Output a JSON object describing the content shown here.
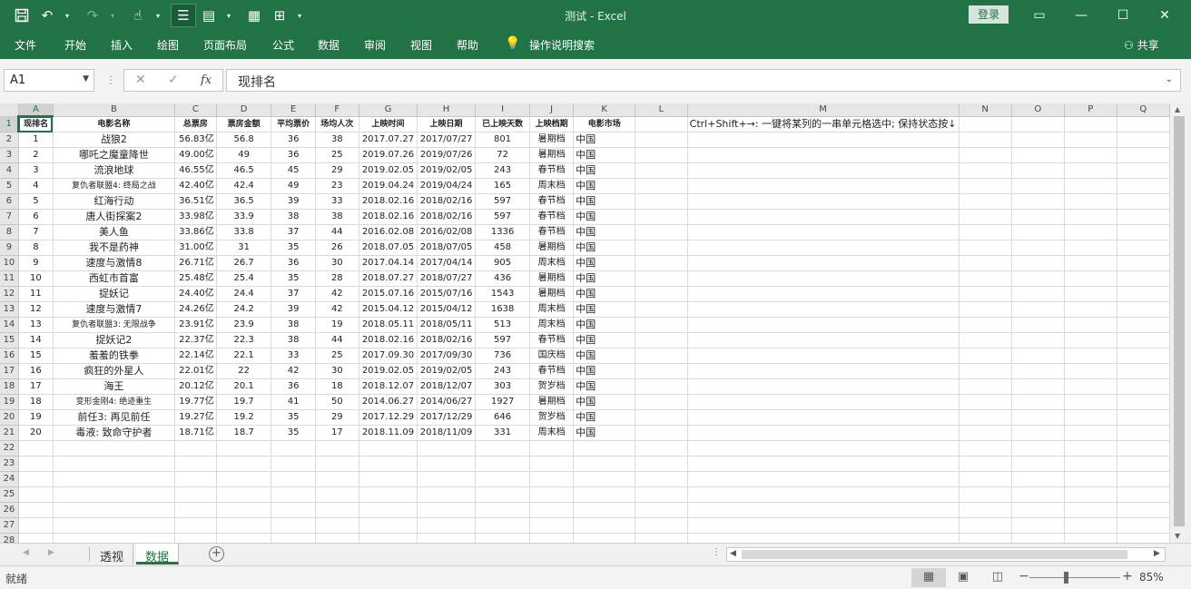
{
  "window": {
    "title": "测试  -  Excel",
    "login_label": "登录"
  },
  "qat": {
    "icons": [
      "save-icon",
      "undo-icon",
      "redo-icon",
      "touch-mode-icon",
      "align-icon",
      "layout-icon",
      "border-icon",
      "grid-icon",
      "customize-icon"
    ]
  },
  "ribbon": {
    "tabs": [
      "文件",
      "开始",
      "插入",
      "绘图",
      "页面布局",
      "公式",
      "数据",
      "审阅",
      "视图",
      "帮助"
    ],
    "tell_me": "操作说明搜索",
    "share": "共享"
  },
  "formula_bar": {
    "name_box": "A1",
    "value": "现排名"
  },
  "sheet": {
    "columns": [
      "A",
      "B",
      "C",
      "D",
      "E",
      "F",
      "G",
      "H",
      "I",
      "J",
      "K",
      "L",
      "M",
      "N",
      "O",
      "P",
      "Q"
    ],
    "headers": [
      "现排名",
      "电影名称",
      "总票房",
      "票房金额",
      "平均票价",
      "场均人次",
      "上映时间",
      "上映日期",
      "已上映天数",
      "上映档期",
      "电影市场"
    ],
    "tip_note": "Ctrl+Shift+→: 一键将某列的一串单元格选中; 保持状态按↓",
    "rows": [
      [
        "1",
        "战狼2",
        "56.83亿",
        "56.8",
        "36",
        "38",
        "2017.07.27",
        "2017/07/27",
        "801",
        "暑期档",
        "中国"
      ],
      [
        "2",
        "哪吒之魔童降世",
        "49.00亿",
        "49",
        "36",
        "25",
        "2019.07.26",
        "2019/07/26",
        "72",
        "暑期档",
        "中国"
      ],
      [
        "3",
        "流浪地球",
        "46.55亿",
        "46.5",
        "45",
        "29",
        "2019.02.05",
        "2019/02/05",
        "243",
        "春节档",
        "中国"
      ],
      [
        "4",
        "复仇者联盟4: 终局之战",
        "42.40亿",
        "42.4",
        "49",
        "23",
        "2019.04.24",
        "2019/04/24",
        "165",
        "周末档",
        "中国"
      ],
      [
        "5",
        "红海行动",
        "36.51亿",
        "36.5",
        "39",
        "33",
        "2018.02.16",
        "2018/02/16",
        "597",
        "春节档",
        "中国"
      ],
      [
        "6",
        "唐人街探案2",
        "33.98亿",
        "33.9",
        "38",
        "38",
        "2018.02.16",
        "2018/02/16",
        "597",
        "春节档",
        "中国"
      ],
      [
        "7",
        "美人鱼",
        "33.86亿",
        "33.8",
        "37",
        "44",
        "2016.02.08",
        "2016/02/08",
        "1336",
        "春节档",
        "中国"
      ],
      [
        "8",
        "我不是药神",
        "31.00亿",
        "31",
        "35",
        "26",
        "2018.07.05",
        "2018/07/05",
        "458",
        "暑期档",
        "中国"
      ],
      [
        "9",
        "速度与激情8",
        "26.71亿",
        "26.7",
        "36",
        "30",
        "2017.04.14",
        "2017/04/14",
        "905",
        "周末档",
        "中国"
      ],
      [
        "10",
        "西虹市首富",
        "25.48亿",
        "25.4",
        "35",
        "28",
        "2018.07.27",
        "2018/07/27",
        "436",
        "暑期档",
        "中国"
      ],
      [
        "11",
        "捉妖记",
        "24.40亿",
        "24.4",
        "37",
        "42",
        "2015.07.16",
        "2015/07/16",
        "1543",
        "暑期档",
        "中国"
      ],
      [
        "12",
        "速度与激情7",
        "24.26亿",
        "24.2",
        "39",
        "42",
        "2015.04.12",
        "2015/04/12",
        "1638",
        "周末档",
        "中国"
      ],
      [
        "13",
        "复仇者联盟3: 无限战争",
        "23.91亿",
        "23.9",
        "38",
        "19",
        "2018.05.11",
        "2018/05/11",
        "513",
        "周末档",
        "中国"
      ],
      [
        "14",
        "捉妖记2",
        "22.37亿",
        "22.3",
        "38",
        "44",
        "2018.02.16",
        "2018/02/16",
        "597",
        "春节档",
        "中国"
      ],
      [
        "15",
        "羞羞的铁拳",
        "22.14亿",
        "22.1",
        "33",
        "25",
        "2017.09.30",
        "2017/09/30",
        "736",
        "国庆档",
        "中国"
      ],
      [
        "16",
        "疯狂的外星人",
        "22.01亿",
        "22",
        "42",
        "30",
        "2019.02.05",
        "2019/02/05",
        "243",
        "春节档",
        "中国"
      ],
      [
        "17",
        "海王",
        "20.12亿",
        "20.1",
        "36",
        "18",
        "2018.12.07",
        "2018/12/07",
        "303",
        "贺岁档",
        "中国"
      ],
      [
        "18",
        "变形金刚4: 绝迹重生",
        "19.77亿",
        "19.7",
        "41",
        "50",
        "2014.06.27",
        "2014/06/27",
        "1927",
        "暑期档",
        "中国"
      ],
      [
        "19",
        "前任3: 再见前任",
        "19.27亿",
        "19.2",
        "35",
        "29",
        "2017.12.29",
        "2017/12/29",
        "646",
        "贺岁档",
        "中国"
      ],
      [
        "20",
        "毒液: 致命守护者",
        "18.71亿",
        "18.7",
        "35",
        "17",
        "2018.11.09",
        "2018/11/09",
        "331",
        "周末档",
        "中国"
      ]
    ],
    "row_numbers": [
      "1",
      "2",
      "3",
      "4",
      "5",
      "6",
      "7",
      "8",
      "9",
      "10",
      "11",
      "12",
      "13",
      "14",
      "15",
      "16",
      "17",
      "18",
      "19",
      "20",
      "21",
      "22",
      "23",
      "24",
      "25",
      "26",
      "27",
      "28"
    ]
  },
  "sheet_tabs": [
    {
      "label": "透视",
      "active": false
    },
    {
      "label": "数据",
      "active": true
    }
  ],
  "status": {
    "ready": "就绪",
    "zoom": "85%",
    "zoom_level": 0.85
  },
  "colors": {
    "brand": "#217346",
    "grid_line": "#dadada",
    "header_bg": "#e6e6e6"
  }
}
